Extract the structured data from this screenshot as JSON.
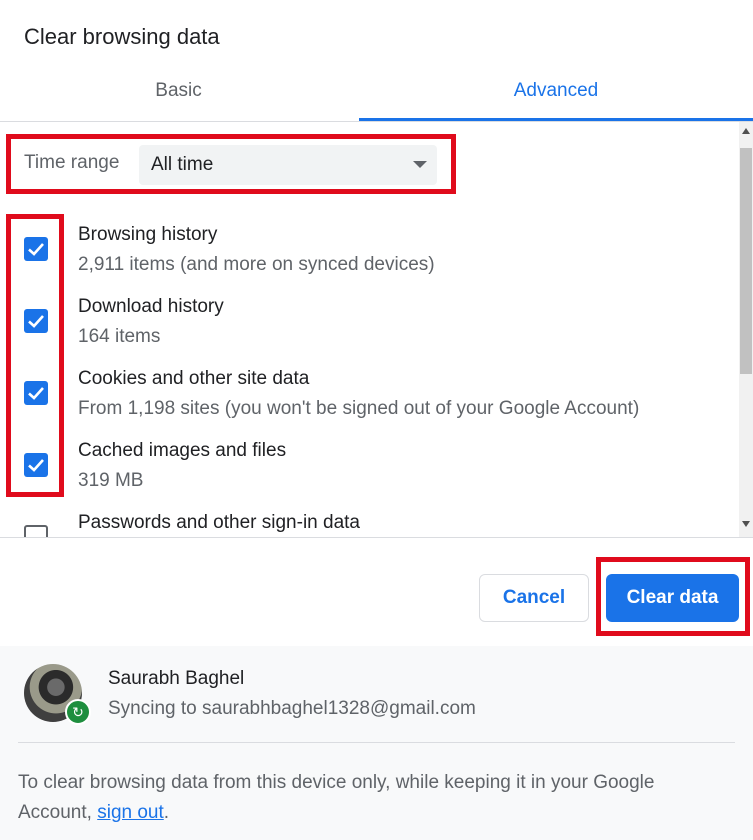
{
  "dialog": {
    "title": "Clear browsing data"
  },
  "tabs": [
    {
      "label": "Basic",
      "active": false
    },
    {
      "label": "Advanced",
      "active": true
    }
  ],
  "time_range": {
    "label": "Time range",
    "value": "All time"
  },
  "items": [
    {
      "title": "Browsing history",
      "subtitle": "2,911 items (and more on synced devices)",
      "checked": true
    },
    {
      "title": "Download history",
      "subtitle": "164 items",
      "checked": true
    },
    {
      "title": "Cookies and other site data",
      "subtitle": "From 1,198 sites (you won't be signed out of your Google Account)",
      "checked": true
    },
    {
      "title": "Cached images and files",
      "subtitle": "319 MB",
      "checked": true
    },
    {
      "title": "Passwords and other sign-in data",
      "subtitle": "",
      "checked": false
    }
  ],
  "buttons": {
    "cancel": "Cancel",
    "clear": "Clear data"
  },
  "account": {
    "name": "Saurabh Baghel",
    "sync_status": "Syncing to saurabhbaghel1328@gmail.com"
  },
  "footer": {
    "text_before": "To clear browsing data from this device only, while keeping it in your Google Account, ",
    "link": "sign out",
    "text_after": "."
  },
  "colors": {
    "accent": "#1a73e8",
    "highlight": "#e00b1c",
    "sync_badge": "#1e8e3e"
  },
  "icons": {
    "check": "checkmark-icon",
    "dropdown": "chevron-down-icon",
    "sync": "sync-icon"
  }
}
